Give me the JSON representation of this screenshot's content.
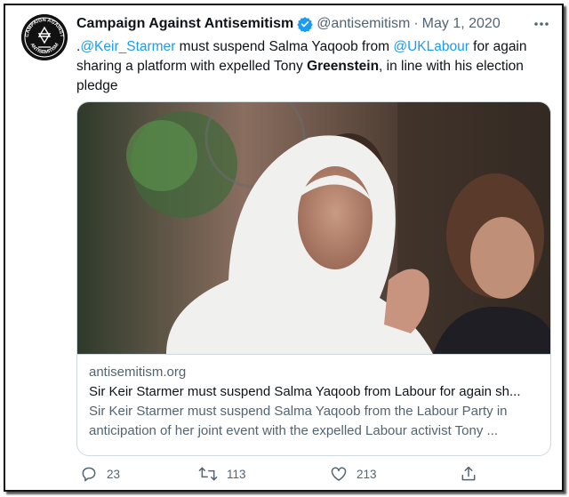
{
  "tweet": {
    "author": {
      "display_name": "Campaign Against Antisemitism",
      "handle": "@antisemitism",
      "verified": true,
      "avatar_text_top": "CAMPAIGN AGAINST",
      "avatar_text_bottom": "ANTISEMITISM"
    },
    "separator": "·",
    "date": "May 1, 2020",
    "text": {
      "prefix": ".",
      "mention1": "@Keir_Starmer",
      "part1": " must suspend Salma Yaqoob from ",
      "mention2": "@UKLabour",
      "part2": " for again sharing a platform with expelled Tony ",
      "bold": "Greenstein",
      "part3": ", in line with his election pledge"
    },
    "card": {
      "domain": "antisemitism.org",
      "title": "Sir Keir Starmer must suspend Salma Yaqoob from Labour for again sh...",
      "description": "Sir Keir Starmer must suspend Salma Yaqoob from the Labour Party in anticipation of her joint event with the expelled Labour activist Tony ..."
    },
    "metrics": {
      "replies": "23",
      "retweets": "113",
      "likes": "213"
    }
  },
  "icons": {
    "verified": "verified-badge-icon",
    "more": "more-options-icon",
    "reply": "reply-icon",
    "retweet": "retweet-icon",
    "like": "heart-icon",
    "share": "share-icon"
  },
  "colors": {
    "link": "#1d9bf0",
    "secondary_text": "#536471",
    "primary_text": "#0f1419",
    "border": "#cfd9de"
  }
}
